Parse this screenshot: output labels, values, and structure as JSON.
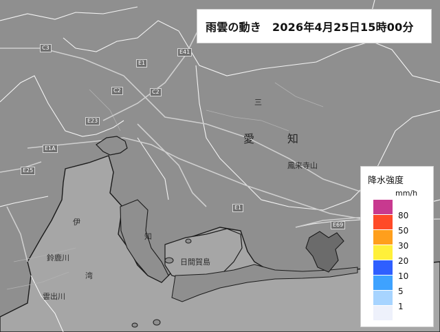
{
  "title": {
    "label": "雨雲の動き",
    "datetime": "2026年4月25日15時00分"
  },
  "legend": {
    "title": "降水強度",
    "unit": "mm/h",
    "items": [
      {
        "value": "80",
        "color": "#c8398f"
      },
      {
        "value": "50",
        "color": "#ff4a28"
      },
      {
        "value": "30",
        "color": "#ff9f1c"
      },
      {
        "value": "20",
        "color": "#fff03a"
      },
      {
        "value": "10",
        "color": "#2f5fff"
      },
      {
        "value": "5",
        "color": "#3ea2ff"
      },
      {
        "value": "1",
        "color": "#a7d4ff"
      },
      {
        "value": "",
        "color": "#eef1fb"
      }
    ]
  },
  "map": {
    "colors": {
      "land": "#8f8f8f",
      "sea": "#a5a5a5",
      "boundary": "#ffffff",
      "road": "#c9c9c9",
      "coast": "#1a1a1a"
    },
    "labels": {
      "aichi_1": "愛",
      "aichi_2": "知",
      "mikawa": "三",
      "ise": "伊",
      "wan": "湾",
      "chita": "知",
      "kumogawa": "雲出川",
      "suzukagawa": "鈴鹿川",
      "shijima": "日間賀島",
      "higashiura": "鳳来寺山"
    },
    "roads": [
      "C3",
      "E1",
      "C2",
      "E1A",
      "E23",
      "E25",
      "E69",
      "E1",
      "C2",
      "E41"
    ]
  }
}
